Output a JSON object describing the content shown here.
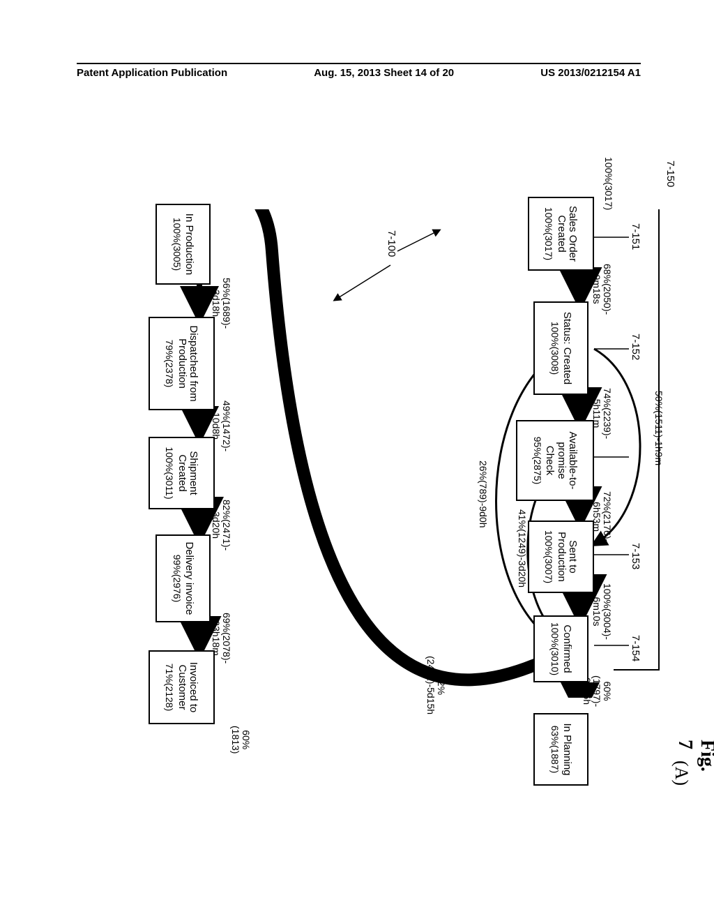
{
  "header": {
    "left": "Patent Application Publication",
    "center": "Aug. 15, 2013  Sheet 14 of 20",
    "right": "US 2013/0212154 A1"
  },
  "figure": {
    "title": "Fig. 7",
    "subtitle": "(A)"
  },
  "refs": {
    "r150": "7-150",
    "r151": "7-151",
    "r152": "7-152",
    "r153": "7-153",
    "r154": "7-154",
    "r100": "7-100"
  },
  "nodes": {
    "start_label": "100%(3017)",
    "sales_order": {
      "title": "Sales Order\nCreated",
      "sub": "100%(3017)"
    },
    "status_created": {
      "title": "Status: Created",
      "sub": "100%(3008)"
    },
    "atp_check": {
      "title": "Available-to-\npromise Check",
      "sub": "95%(2875)"
    },
    "sent_prod": {
      "title": "Sent to\nProduction",
      "sub": "100%(3007)"
    },
    "confirmed": {
      "title": "Confirmed",
      "sub": "100%(3010)"
    },
    "in_planning": {
      "title": "In Planning",
      "sub": "63%(1887)"
    },
    "in_production": {
      "title": "In Production",
      "sub": "100%(3005)"
    },
    "dispatched": {
      "title": "Dispatched from\nProduction",
      "sub": "79%(2378)"
    },
    "shipment": {
      "title": "Shipment\nCreated",
      "sub": "100%(3011)"
    },
    "delivery": {
      "title": "Delivery invoice",
      "sub": "99%(2976)"
    },
    "invoiced": {
      "title": "Invoiced to\nCustomer",
      "sub": "71%(2128)"
    },
    "end_label": "60%(1813)"
  },
  "edges": {
    "e_so_sc": "68%(2050)-\n9m18s",
    "e_sc_atp": "74%(2239)-\n5h11m",
    "e_atp_sp": "72%(2176)-\n6h53m",
    "e_sp_cf": "100%(3004)-\n6m10s",
    "e_cf_ip": "60%(1797)-\n23d5h",
    "e_sc_sp": "50%(1511)-1h9m",
    "e_atp_cf": "41%(1249)-3d20h",
    "e_sc_cf": "26%(789)-9d0h",
    "e_cf_inprod": "82%(2471)-5d15h",
    "e_inprod_disp": "56%(1689)-\n3d18h",
    "e_disp_ship": "49%(1472)-\n10d8h",
    "e_ship_deliv": "82%(2471)-\n3d20h",
    "e_deliv_inv": "69%(2078)-\n23h18m"
  }
}
